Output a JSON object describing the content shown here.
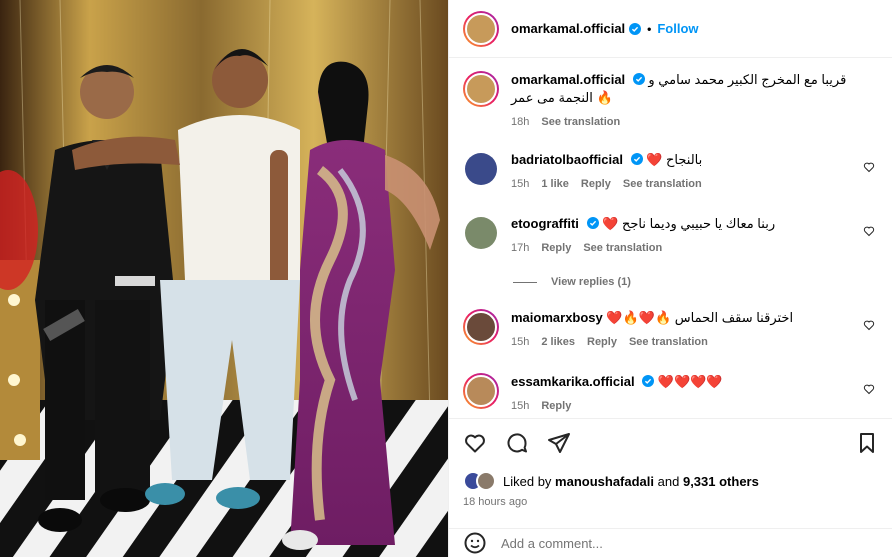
{
  "post": {
    "author": "omarkamal.official",
    "follow_label": "Follow",
    "dot": "•",
    "caption_text": "قريبا مع المخرج الكبير محمد سامي و النجمة مى عمر",
    "caption_emoji": "🔥",
    "caption_time": "18h",
    "see_translation": "See translation"
  },
  "comments": [
    {
      "user": "badriatolbaofficial",
      "text": "بالنجاح",
      "emoji": "❤️",
      "time": "15h",
      "likes": "1 like",
      "reply": "Reply",
      "translate": "See translation"
    },
    {
      "user": "etoograffiti",
      "text": "ربنا معاك يا حبيبي وديما ناجح",
      "emoji": "❤️",
      "time": "17h",
      "reply": "Reply",
      "translate": "See translation"
    },
    {
      "user": "maiomarxbosy",
      "text": "اخترقنا سقف الحماس",
      "emoji": "❤️🔥❤️🔥",
      "time": "15h",
      "likes": "2 likes",
      "reply": "Reply",
      "translate": "See translation"
    },
    {
      "user": "essamkarika.official",
      "text": "",
      "emoji": "❤️❤️❤️❤️",
      "time": "15h",
      "reply": "Reply"
    }
  ],
  "view_replies": "View replies (1)",
  "likes": {
    "prefix": "Liked by",
    "user": "manoushafadali",
    "and": "and",
    "others": "9,331 others"
  },
  "post_time": "18 hours ago",
  "add_comment": {
    "placeholder": "Add a comment..."
  },
  "icons": {
    "like": "heart-icon",
    "comment": "comment-icon",
    "share": "share-icon",
    "save": "bookmark-icon",
    "emoji": "emoji-icon",
    "verified": "verified-icon"
  },
  "colors": {
    "accent": "#0095f6",
    "verified": "#0095f6",
    "heart": "#ed4956",
    "muted": "#737373"
  }
}
